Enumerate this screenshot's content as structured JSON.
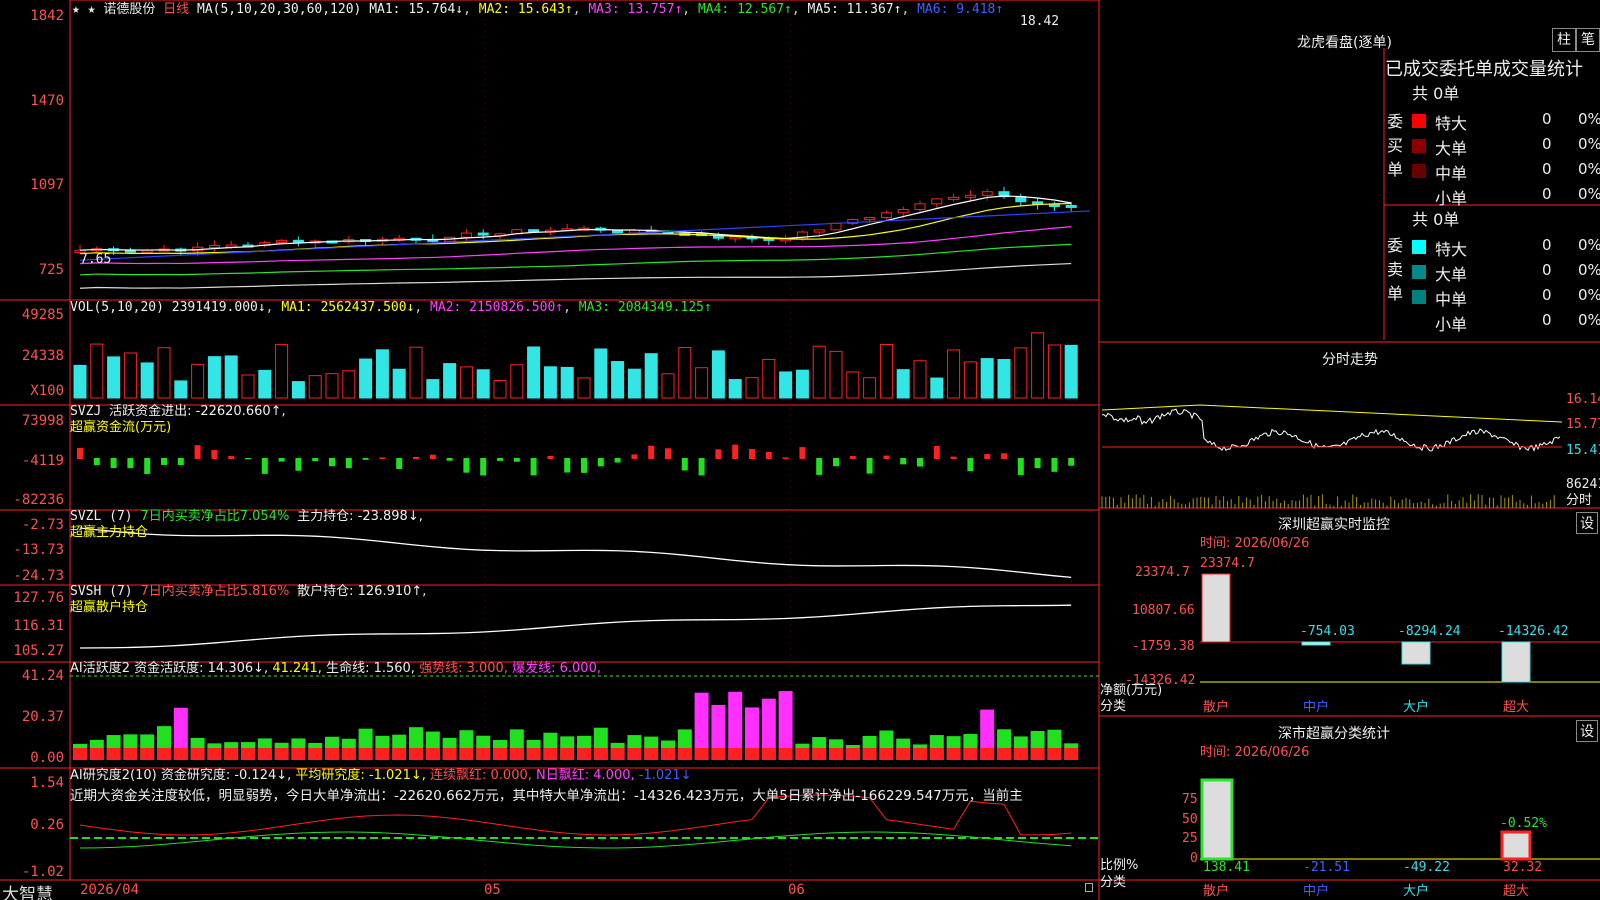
{
  "app": {
    "brand": "大智慧",
    "symbol": "诺德股份",
    "period": "日线",
    "stars": "★ ★"
  },
  "main": {
    "ma_label": "MA(5,10,20,30,60,120)",
    "ma1": "MA1: 15.764↓",
    "ma2": "MA2: 15.643↑",
    "ma3": "MA3: 13.757↑",
    "ma4": "MA4: 12.567↑",
    "ma5": "MA5: 11.367↑",
    "ma6": "MA6: 9.418↑",
    "yticks": [
      "1842",
      "1470",
      "1097",
      "725"
    ],
    "high": "18.42",
    "low": "7.65"
  },
  "vol": {
    "label": "VOL(5,10,20)",
    "value": "2391419.000↓",
    "ma1": "MA1: 2562437.500↓",
    "ma2": "MA2: 2150826.500↑",
    "ma3": "MA3: 2084349.125↑",
    "yticks": [
      "49285",
      "24338",
      "X100"
    ]
  },
  "svzj": {
    "label": "SVZJ",
    "text": "活跃资金进出: -22620.660↑,",
    "sub": "超赢资金流(万元)",
    "yticks": [
      "73998",
      "-4119",
      "-82236"
    ]
  },
  "svzl": {
    "label": "SVZL (7)",
    "text": "7日内买卖净占比7.054%",
    "text2": "主力持仓: -23.898↓,",
    "sub": "超赢主力持仓",
    "yticks": [
      "-2.73",
      "-13.73",
      "-24.73"
    ]
  },
  "svsh": {
    "label": "SVSH (7)",
    "text": "7日内买卖净占比5.816%",
    "text2": "散户持仓: 126.910↑,",
    "sub": "超赢散户持仓",
    "yticks": [
      "127.76",
      "116.31",
      "105.27"
    ]
  },
  "ai1": {
    "label": "AI活跃度2",
    "t1": "资金活跃度: 14.306↓,",
    "t2": "41.241,",
    "t3": "生命线: 1.560,",
    "t4": "强势线: 3.000,",
    "t5": "爆发线: 6.000,",
    "yticks": [
      "41.24",
      "20.37",
      "0.00"
    ]
  },
  "ai2": {
    "label": "AI研究度2(10)",
    "t1": "资金研究度: -0.124↓,",
    "t2": "平均研究度: -1.021↓,",
    "t3": "连续飘红: 0.000,",
    "t4": "N日飘红: 4.000,",
    "t5": "-1.021↓",
    "desc": "近期大资金关注度较低，明显弱势，今日大单净流出：-22620.662万元，其中特大单净流出：-14326.423万元，大单5日累计净出-166229.547万元，当前主",
    "yticks": [
      "1.54",
      "0.26",
      "-1.02"
    ]
  },
  "xaxis": [
    "2026/04",
    "05",
    "06"
  ],
  "right": {
    "title": "龙虎看盘(逐单)",
    "btn1": "柱",
    "btn2": "笔",
    "header": "已成交委托单成交量统计",
    "buy_label": "委买单",
    "sell_label": "委卖单",
    "buy_total": "共 0单",
    "sell_total": "共 0单",
    "rows": [
      {
        "name": "特大",
        "v": "0",
        "p": "0%"
      },
      {
        "name": "大单",
        "v": "0",
        "p": "0%"
      },
      {
        "name": "中单",
        "v": "0",
        "p": "0%"
      },
      {
        "name": "小单",
        "v": "0",
        "p": "0%"
      }
    ],
    "fenshi": "分时走势",
    "fs_ticks": [
      "16.14",
      "15.77",
      "15.41",
      "86241",
      "分时"
    ],
    "sz_title": "深圳超赢实时监控",
    "sz_time": "时间: 2026/06/26",
    "sz_set": "设",
    "sz_ticks": [
      "23374.7",
      "10807.66",
      "-1759.38",
      "-14326.42"
    ],
    "sz_vals": [
      "23374.7",
      "-754.03",
      "-8294.24",
      "-14326.42"
    ],
    "sz_unit": "净额(万元)",
    "sz_cat": "分类",
    "cats": [
      "散户",
      "中户",
      "大户",
      "超大"
    ],
    "fl_title": "深市超赢分类统计",
    "fl_time": "时间: 2026/06/26",
    "fl_set": "设",
    "fl_ticks": [
      "75",
      "50",
      "25",
      "0"
    ],
    "fl_unit": "比例%",
    "fl_cat": "分类",
    "fl_vals": [
      "138.41",
      "-21.51",
      "-49.22",
      "32.32"
    ],
    "fl_top": "-0.52%"
  }
}
